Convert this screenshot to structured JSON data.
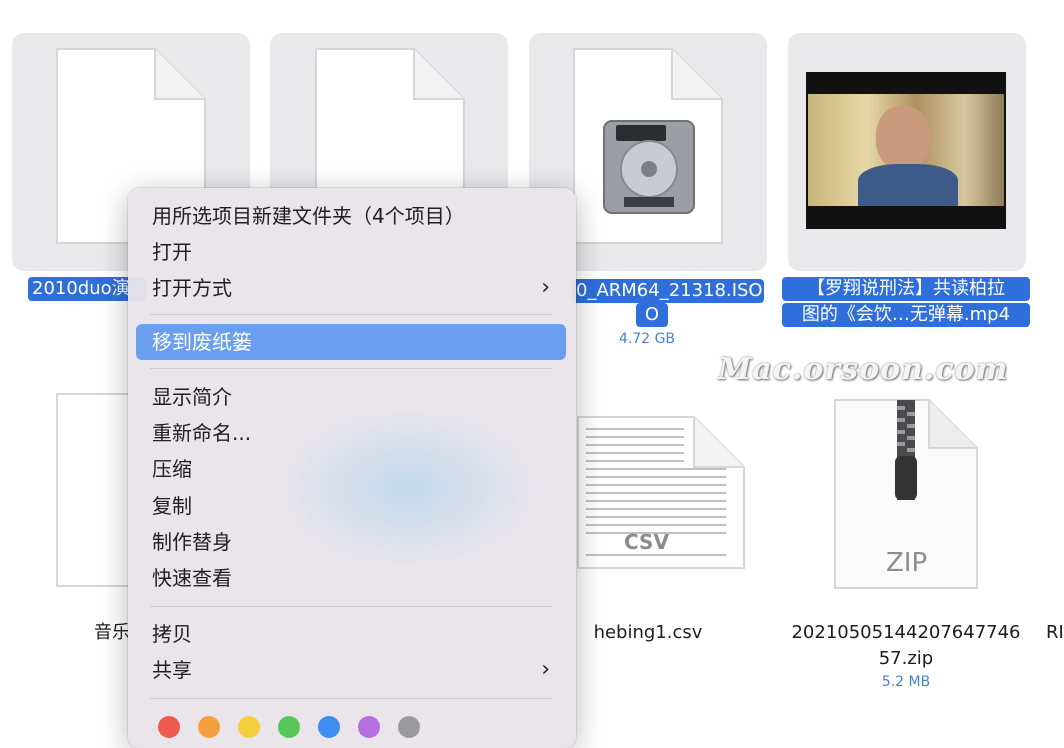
{
  "files": [
    {
      "name": "2010duo演",
      "selected": true
    },
    {
      "name": "",
      "selected": true
    },
    {
      "name": "0_ARM64_21318.ISO",
      "name_line2": "O",
      "size": "4.72 GB",
      "selected": true
    },
    {
      "name": "【罗翔说刑法】共读柏拉",
      "name_line2": "图的《会饮…无弹幕.mp4",
      "selected": true
    },
    {
      "name": "音乐"
    },
    {
      "name": "hebing1.csv",
      "badge": "CSV"
    },
    {
      "name": "2021050514420764774 6",
      "line1": "20210505144207647746",
      "line2": "57.zip",
      "size": "5.2 MB",
      "badge": "ZIP"
    },
    {
      "name": "RI"
    }
  ],
  "watermark": "Mac.orsoon.com",
  "menu": {
    "items": [
      {
        "label": "用所选项目新建文件夹（4个项目）"
      },
      {
        "label": "打开"
      },
      {
        "label": "打开方式",
        "submenu": true
      },
      {
        "label": "移到废纸篓",
        "highlighted": true
      },
      {
        "label": "显示简介"
      },
      {
        "label": "重新命名..."
      },
      {
        "label": "压缩"
      },
      {
        "label": "复制"
      },
      {
        "label": "制作替身"
      },
      {
        "label": "快速查看"
      },
      {
        "label": "拷贝"
      },
      {
        "label": "共享",
        "submenu": true
      }
    ],
    "chevron": "›",
    "tag_colors": [
      "#ee5a4f",
      "#f4a03c",
      "#f4cf3e",
      "#58c75a",
      "#3d8ef0",
      "#b56fe0",
      "#9a9a9e"
    ]
  }
}
